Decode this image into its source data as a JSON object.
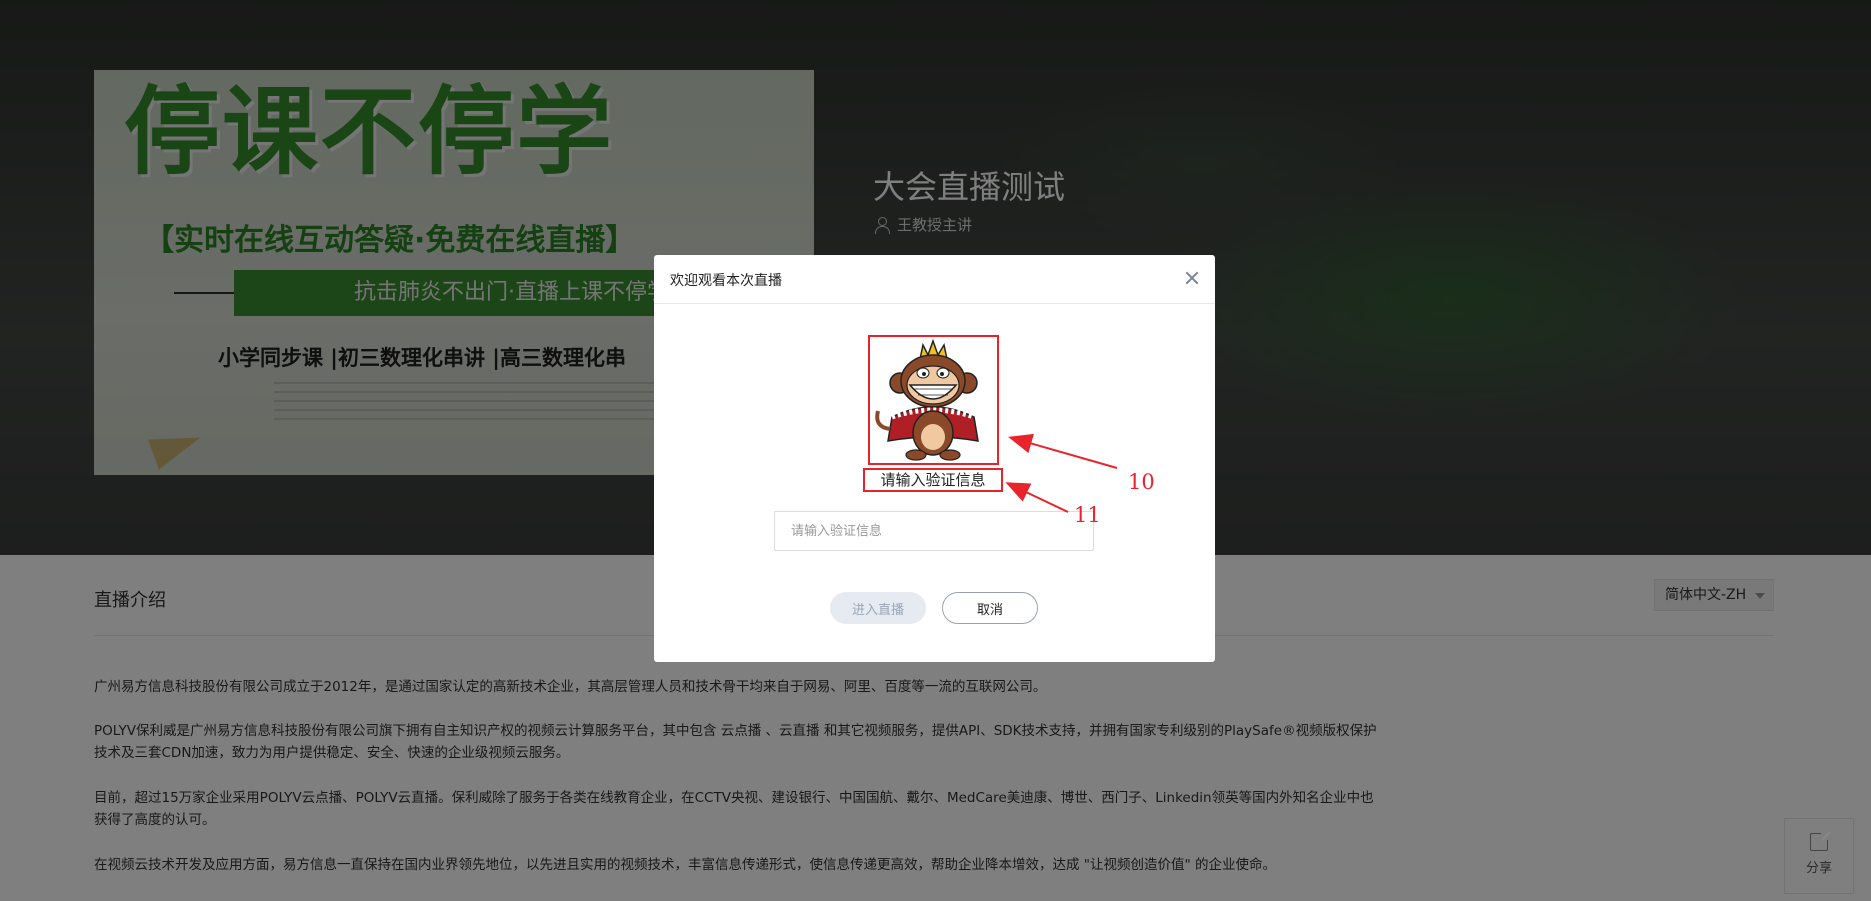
{
  "hero": {
    "cover": {
      "headline": "停课不停学",
      "subheadline": "【实时在线互动答疑·免费在线直播】",
      "ribbon": "抗击肺炎不出门·直播上课不停学",
      "courses": "小学同步课 |初三数理化串讲 |高三数理化串"
    },
    "title": "大会直播测试",
    "host": "王教授主讲"
  },
  "intro": {
    "header": "直播介绍",
    "language": "简体中文-ZH",
    "paragraphs": [
      "广州易方信息科技股份有限公司成立于2012年，是通过国家认定的高新技术企业，其高层管理人员和技术骨干均来自于网易、阿里、百度等一流的互联网公司。",
      "POLYV保利威是广州易方信息科技股份有限公司旗下拥有自主知识产权的视频云计算服务平台，其中包含 云点播 、云直播 和其它视频服务，提供API、SDK技术支持，并拥有国家专利级别的PlaySafe®视频版权保护技术及三套CDN加速，致力为用户提供稳定、安全、快速的企业级视频云服务。",
      "目前，超过15万家企业采用POLYV云点播、POLYV云直播。保利威除了服务于各类在线教育企业，在CCTV央视、建设银行、中国国航、戴尔、MedCare美迪康、博世、西门子、Linkedin领英等国内外知名企业中也获得了高度的认可。",
      "在视频云技术开发及应用方面，易方信息一直保持在国内业界领先地位，以先进且实用的视频技术，丰富信息传递形式，使信息传递更高效，帮助企业降本增效，达成 \"让视频创造价值\" 的企业使命。"
    ]
  },
  "share": {
    "label": "分享",
    "icon": "share-icon"
  },
  "dialog": {
    "title": "欢迎观看本次直播",
    "avatar_icon": "monkey-king-avatar",
    "verify_label": "请输入验证信息",
    "input_placeholder": "请输入验证信息",
    "input_value": "",
    "enter_label": "进入直播",
    "cancel_label": "取消"
  },
  "annotations": {
    "label_a": "10",
    "label_b": "11",
    "color": "#e8232a"
  }
}
